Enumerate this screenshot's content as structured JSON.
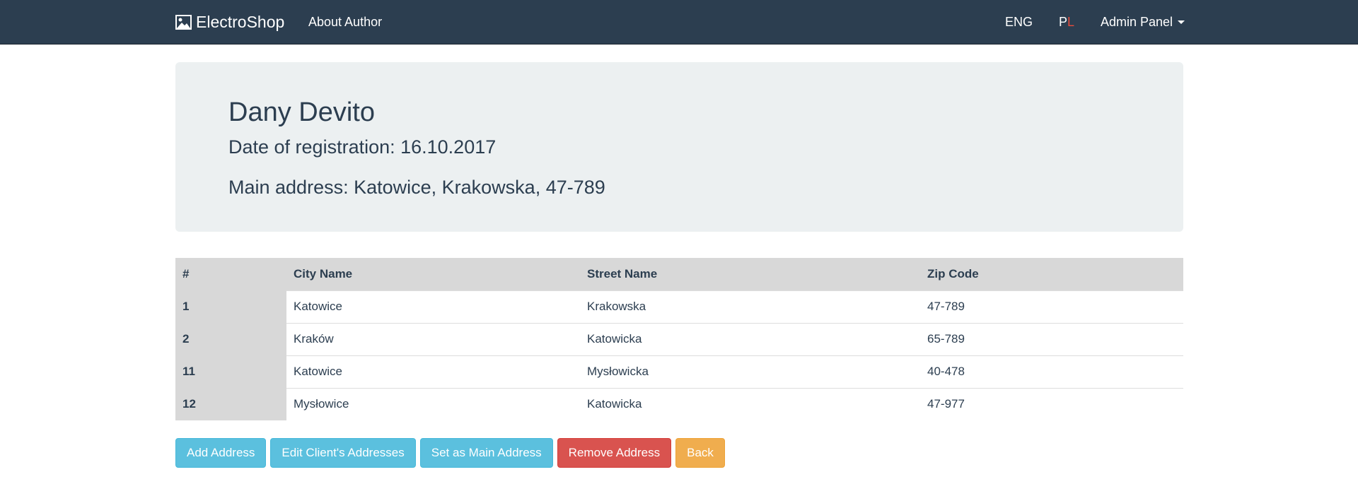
{
  "navbar": {
    "brand": "ElectroShop",
    "brand_icon": "image-icon",
    "about": "About Author",
    "lang_eng": "ENG",
    "lang_pl_p": "P",
    "lang_pl_l": "L",
    "admin": "Admin Panel",
    "colors": {
      "background": "#2c3e50",
      "pl_accent": "#e74c3c"
    }
  },
  "client": {
    "name": "Dany Devito",
    "registration": "Date of registration: 16.10.2017",
    "main_address": "Main address: Katowice, Krakowska, 47-789"
  },
  "table": {
    "headers": [
      "#",
      "City Name",
      "Street Name",
      "Zip Code"
    ],
    "rows": [
      [
        "1",
        "Katowice",
        "Krakowska",
        "47-789"
      ],
      [
        "2",
        "Kraków",
        "Katowicka",
        "65-789"
      ],
      [
        "11",
        "Katowice",
        "Mysłowicka",
        "40-478"
      ],
      [
        "12",
        "Mysłowice",
        "Katowicka",
        "47-977"
      ]
    ]
  },
  "buttons": {
    "add": "Add Address",
    "edit": "Edit Client's Addresses",
    "set_main": "Set as Main Address",
    "remove": "Remove Address",
    "back": "Back",
    "colors": {
      "info": "#5bc0de",
      "danger": "#d9534f",
      "warning": "#f0ad4e"
    }
  }
}
